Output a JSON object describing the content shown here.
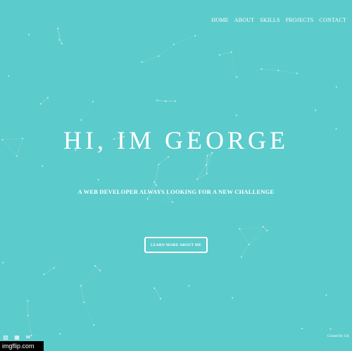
{
  "nav": {
    "items": [
      {
        "label": "HOME"
      },
      {
        "label": "ABOUT"
      },
      {
        "label": "SKILLS"
      },
      {
        "label": "PROJECTS"
      },
      {
        "label": "CONTACT"
      }
    ]
  },
  "hero": {
    "title": "HI, IM GEORGE",
    "subtitle": "A WEB DEVELOPER ALWAYS LOOKING FOR A NEW CHALLENGE",
    "cta_label": "LEARN MORE ABOUT ME"
  },
  "footer": {
    "social_icons": [
      "github-icon",
      "linkedin-icon",
      "mail-icon"
    ],
    "credit": "Created By GK"
  },
  "watermark": {
    "text": "imgflip.com"
  },
  "colors": {
    "background": "#5ccbcb",
    "foreground": "#ffffff"
  }
}
